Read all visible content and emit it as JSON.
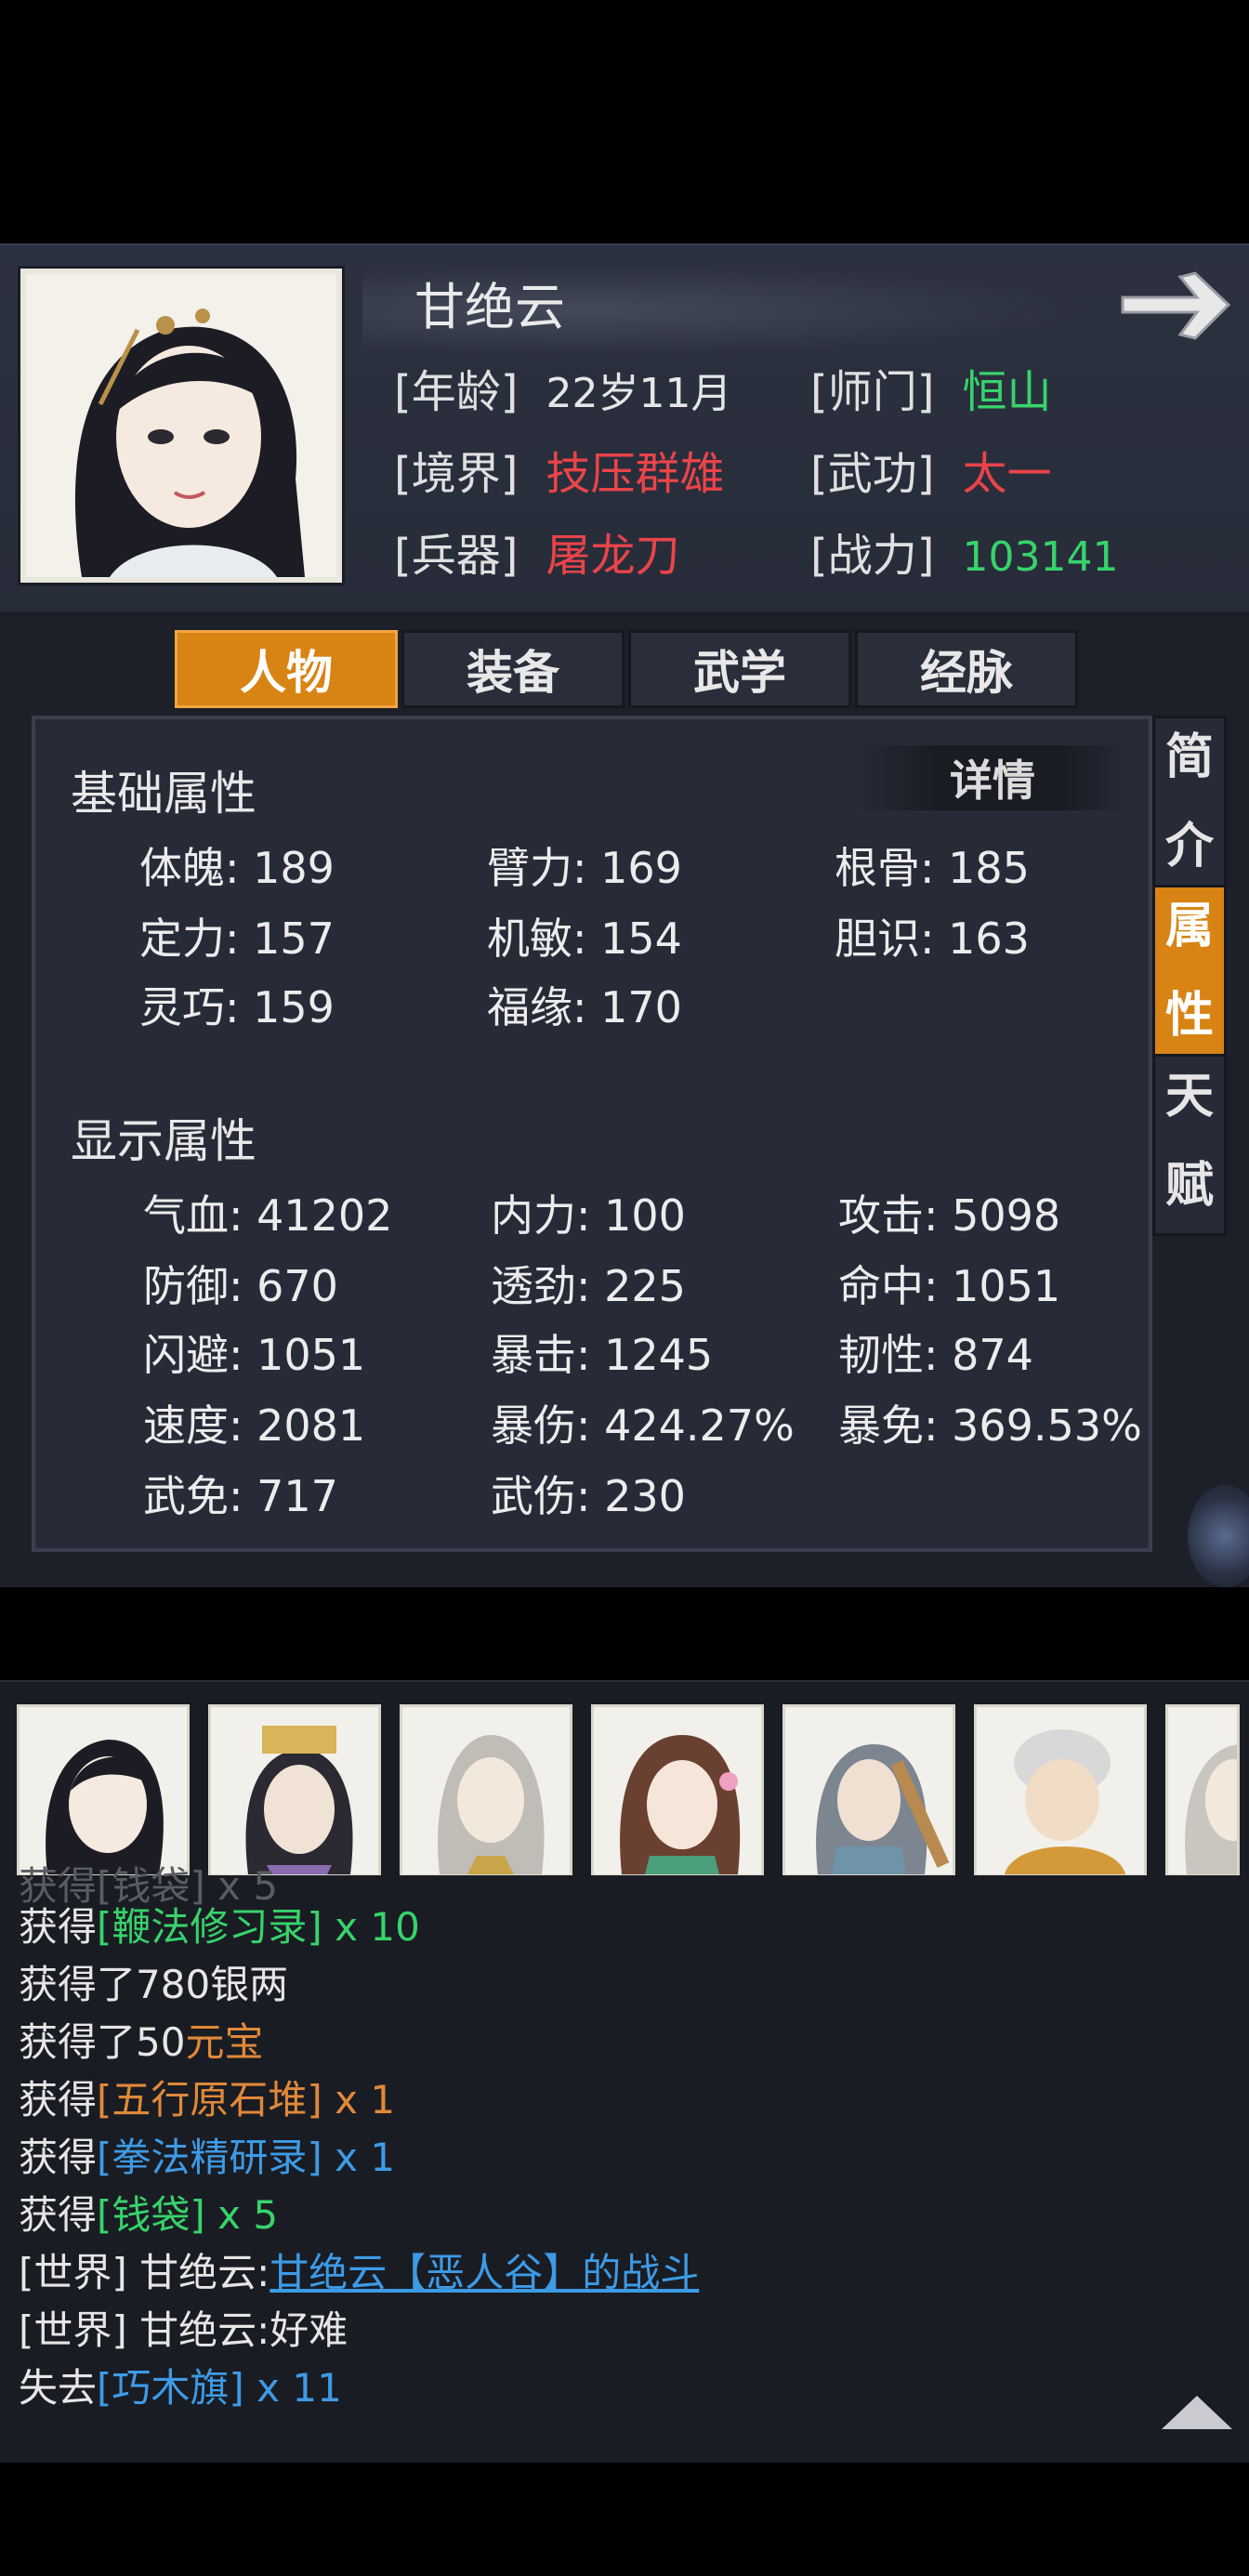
{
  "character": {
    "name": "甘绝云",
    "age_label": "[年龄]",
    "age_value": "22岁11月",
    "sect_label": "[师门]",
    "sect_value": "恒山",
    "realm_label": "[境界]",
    "realm_value": "技压群雄",
    "martial_label": "[武功]",
    "martial_value": "太一",
    "weapon_label": "[兵器]",
    "weapon_value": "屠龙刀",
    "power_label": "[战力]",
    "power_value": "103141"
  },
  "tabs": [
    "人物",
    "装备",
    "武学",
    "经脉"
  ],
  "side_tabs": [
    {
      "c1": "简",
      "c2": "介"
    },
    {
      "c1": "属",
      "c2": "性"
    },
    {
      "c1": "天",
      "c2": "赋"
    }
  ],
  "detail_label": "详情",
  "basic": {
    "title": "基础属性",
    "stats": [
      "体魄: 189",
      "臂力: 169",
      "根骨: 185",
      "定力: 157",
      "机敏: 154",
      "胆识: 163",
      "灵巧: 159",
      "福缘: 170"
    ]
  },
  "display": {
    "title": "显示属性",
    "stats": [
      "气血: 41202",
      "内力: 100",
      "攻击: 5098",
      "防御: 670",
      "透劲: 225",
      "命中: 1051",
      "闪避: 1051",
      "暴击: 1245",
      "韧性: 874",
      "速度: 2081",
      "暴伤: 424.27%",
      "暴免: 369.53%",
      "武免: 717",
      "武伤: 230"
    ]
  },
  "log": {
    "l0a": "获得",
    "l0b": "[鞭法修习录]",
    "l0c": " x 10",
    "l1": "获得了780银两",
    "l2a": "获得了50",
    "l2b": "元宝",
    "l3a": "获得",
    "l3b": "[五行原石堆]",
    "l3c": " x 1",
    "l4a": "获得",
    "l4b": "[拳法精研录]",
    "l4c": " x 1",
    "l5a": "获得",
    "l5b": "[钱袋]",
    "l5c": " x 5",
    "l6a": "[世界] 甘绝云:",
    "l6b": "甘绝云【恶人谷】的战斗",
    "l7": "[世界] 甘绝云:好难",
    "l8a": "失去",
    "l8b": "[巧木旗]",
    "l8c": " x 11"
  }
}
